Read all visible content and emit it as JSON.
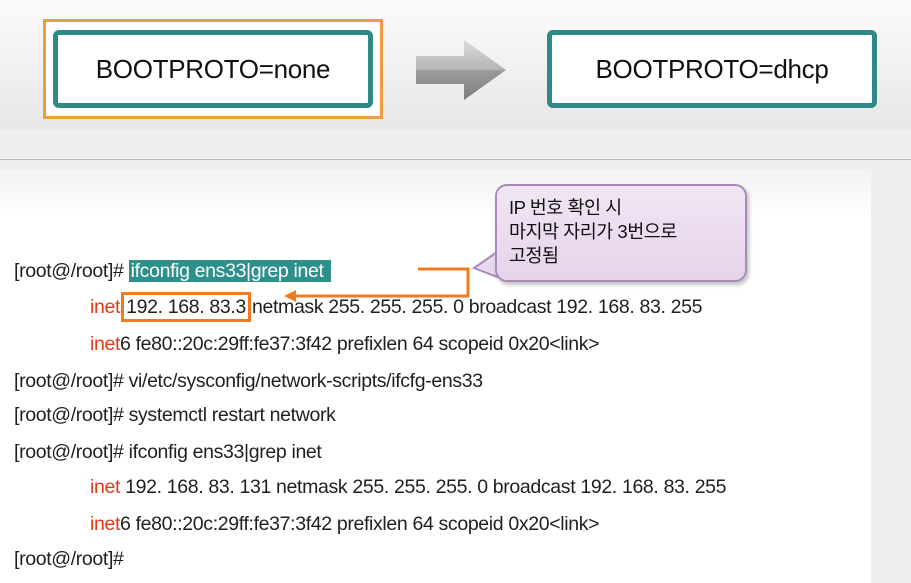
{
  "before_box": {
    "label": "BOOTPROTO=none"
  },
  "after_box": {
    "label": "BOOTPROTO=dhcp"
  },
  "callout": {
    "lines": [
      "IP 번호 확인 시",
      "마지막 자리가 3번으로",
      "고정됨"
    ]
  },
  "terminal": {
    "line1": {
      "prompt": "[root@/root]# ",
      "cmd": "ifconfig ens33|grep inet "
    },
    "line2": {
      "kw": "inet",
      "ip": "192. 168. 83.3",
      "rest": " netmask 255. 255. 255. 0 broadcast 192. 168. 83. 255"
    },
    "line3": {
      "kw": "inet",
      "rest": "6 fe80::20c:29ff:fe37:3f42 prefixlen 64 scopeid 0x20<link>"
    },
    "line4": "[root@/root]# vi/etc/sysconfig/network-scripts/ifcfg-ens33",
    "line5": "[root@/root]# systemctl restart network",
    "line6": "[root@/root]# ifconfig ens33|grep inet",
    "line7": {
      "kw": "inet",
      "rest": " 192. 168. 83. 131 netmask 255. 255. 255. 0 broadcast 192. 168. 83. 255"
    },
    "line8": {
      "kw": "inet",
      "rest": "6 fe80::20c:29ff:fe37:3f42 prefixlen 64 scopeid 0x20<link>"
    },
    "line9": "[root@/root]#"
  },
  "colors": {
    "box_border": "#2e8a85",
    "highlight_orange": "#f07a1f",
    "keyword_red": "#e03a1a",
    "callout_fill": "#e9dbee"
  },
  "icons": {
    "arrow": "right-arrow-icon"
  }
}
